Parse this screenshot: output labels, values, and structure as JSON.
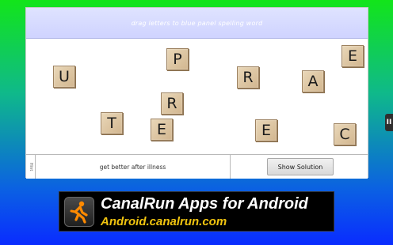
{
  "game": {
    "instruction": "drag letters to blue panel spelling word",
    "tiles": [
      "U",
      "P",
      "R",
      "E",
      "A",
      "R",
      "T",
      "E",
      "E",
      "C"
    ],
    "hint_tab_label": "Hint",
    "hint_text": "get better after illness",
    "show_solution_label": "Show Solution"
  },
  "side_handle": {
    "label": "II"
  },
  "ad": {
    "title": "CanalRun Apps for Android",
    "url": "Android.canalrun.com",
    "logo_icon": "runner-icon"
  },
  "colors": {
    "ad_url": "#f1c40f",
    "tile": "#dcc39f",
    "instruction_bar": "#d8dcff"
  }
}
